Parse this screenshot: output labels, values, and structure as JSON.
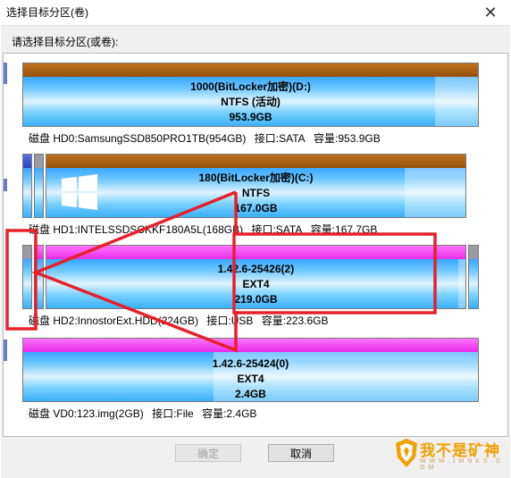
{
  "window": {
    "title": "选择目标分区(卷)",
    "close_glyph": "✕"
  },
  "prompt": "请选择目标分区(或卷):",
  "disks": [
    {
      "partition": {
        "line1": "1000(BitLocker加密)(D:)",
        "line2": "NTFS (活动)",
        "line3": "953.9GB"
      },
      "info": {
        "name": "磁盘 HD0:SamsungSSD850PRO1TB(954GB)",
        "interface": "接口:SATA",
        "capacity": "容量:953.9GB"
      }
    },
    {
      "partition": {
        "line1": "180(BitLocker加密)(C:)",
        "line2": "NTFS",
        "line3": "167.0GB"
      },
      "info": {
        "name": "磁盘 HD1:INTELSSDSCKKF180A5L(168GB)",
        "interface": "接口:SATA",
        "capacity": "容量:167.7GB"
      }
    },
    {
      "partition": {
        "line1": "1.42.6-25426(2)",
        "line2": "EXT4",
        "line3": "219.0GB"
      },
      "info": {
        "name": "磁盘 HD2:InnostorExt.HDD(224GB)",
        "interface": "接口:USB",
        "capacity": "容量:223.6GB"
      }
    },
    {
      "partition": {
        "line1": "1.42.6-25424(0)",
        "line2": "EXT4",
        "line3": "2.4GB"
      },
      "info": {
        "name": "磁盘 VD0:123.img(2GB)",
        "interface": "接口:File",
        "capacity": "容量:2.4GB"
      }
    }
  ],
  "buttons": {
    "ok": "确定",
    "cancel": "取消"
  },
  "watermark": {
    "text": "我不是矿神",
    "sub": "W W W . I M N K S . C O M"
  },
  "colors": {
    "annotation": "#e8202a",
    "ext_cap": "#f040f0",
    "ntfs_cap": "#a8600e",
    "watermark": "#f0a000"
  }
}
